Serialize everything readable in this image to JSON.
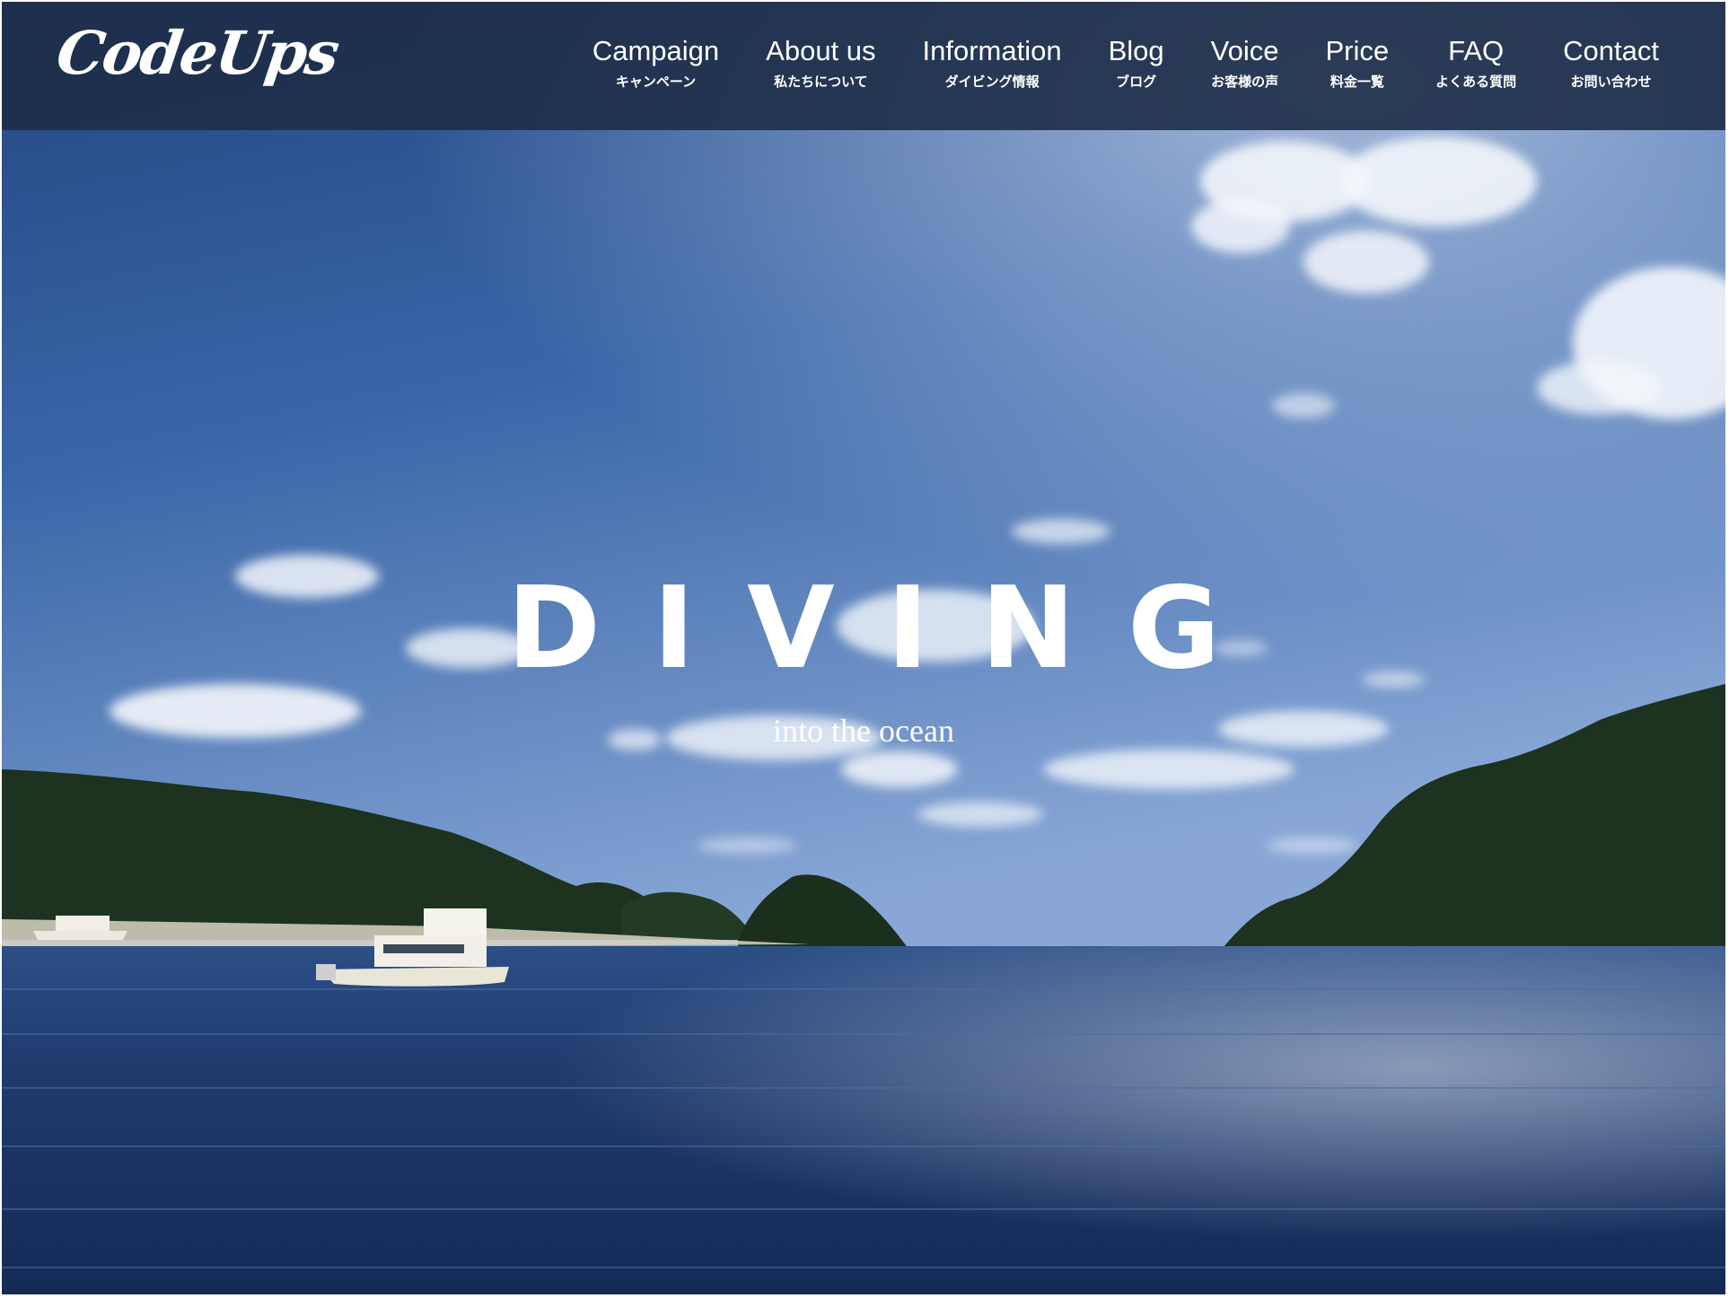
{
  "logo": {
    "text": "CodeUps"
  },
  "nav": {
    "items": [
      {
        "en": "Campaign",
        "ja": "キャンペーン"
      },
      {
        "en": "About us",
        "ja": "私たちについて"
      },
      {
        "en": "Information",
        "ja": "ダイビング情報"
      },
      {
        "en": "Blog",
        "ja": "ブログ"
      },
      {
        "en": "Voice",
        "ja": "お客様の声"
      },
      {
        "en": "Price",
        "ja": "料金一覧"
      },
      {
        "en": "FAQ",
        "ja": "よくある質問"
      },
      {
        "en": "Contact",
        "ja": "お問い合わせ"
      }
    ]
  },
  "hero": {
    "title": "DIVING",
    "subtitle": "into the ocean"
  },
  "colors": {
    "header_bg": "#1e2d48",
    "sky_top": "#274a86",
    "sky_bottom": "#7d9ed0",
    "sea": "#1c3566",
    "hills": "#1f3220",
    "text": "#ffffff"
  }
}
